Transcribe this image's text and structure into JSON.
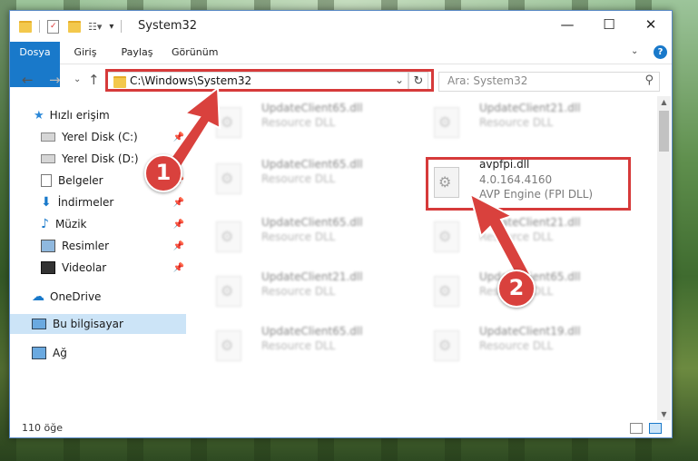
{
  "window": {
    "title": "System32"
  },
  "ribbon": {
    "tabs": [
      "Dosya",
      "Giriş",
      "Paylaş",
      "Görünüm"
    ]
  },
  "nav": {
    "address": "C:\\Windows\\System32",
    "search_placeholder": "Ara: System32"
  },
  "sidebar": {
    "items": [
      {
        "label": "Hızlı erişim",
        "icon": "star-icon"
      },
      {
        "label": "Yerel Disk (C:)",
        "icon": "drive-icon"
      },
      {
        "label": "Yerel Disk (D:)",
        "icon": "drive-icon"
      },
      {
        "label": "Belgeler",
        "icon": "document-icon"
      },
      {
        "label": "İndirmeler",
        "icon": "download-icon"
      },
      {
        "label": "Müzik",
        "icon": "music-icon"
      },
      {
        "label": "Resimler",
        "icon": "image-icon"
      },
      {
        "label": "Videolar",
        "icon": "video-icon"
      },
      {
        "label": "OneDrive",
        "icon": "cloud-icon"
      },
      {
        "label": "Bu bilgisayar",
        "icon": "computer-icon"
      },
      {
        "label": "Ağ",
        "icon": "network-icon"
      }
    ]
  },
  "files": [
    {
      "name": "UpdateClient65.dll",
      "desc": "Resource DLL"
    },
    {
      "name": "UpdateClient21.dll",
      "desc": "Resource DLL"
    },
    {
      "name": "UpdateClient65.dll",
      "desc": "Resource DLL"
    },
    {
      "name": "avpfpi.dll",
      "desc": "4.0.164.4160",
      "desc2": "AVP Engine (FPI DLL)"
    },
    {
      "name": "UpdateClient65.dll",
      "desc": "Resource DLL"
    },
    {
      "name": "UpdateClient21.dll",
      "desc": "Resource DLL"
    },
    {
      "name": "UpdateClient21.dll",
      "desc": "Resource DLL"
    },
    {
      "name": "UpdateClient65.dll",
      "desc": "Resource DLL"
    },
    {
      "name": "UpdateClient65.dll",
      "desc": "Resource DLL"
    },
    {
      "name": "UpdateClient19.dll",
      "desc": "Resource DLL"
    }
  ],
  "status": {
    "count": "110 öğe"
  },
  "callouts": {
    "one": "1",
    "two": "2"
  },
  "colors": {
    "accent": "#1979ca",
    "highlight": "#d63a3a",
    "selected": "#cce4f7"
  }
}
